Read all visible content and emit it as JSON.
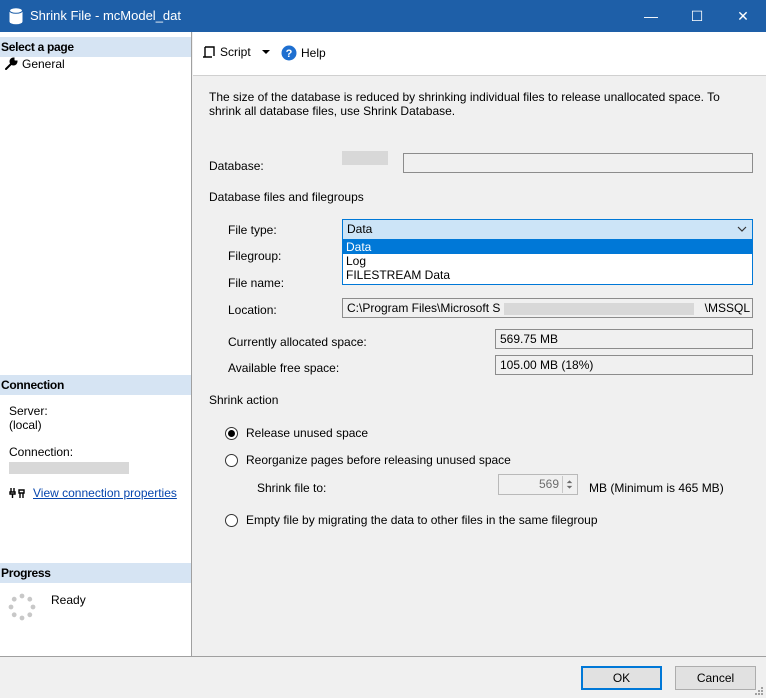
{
  "window": {
    "title": "Shrink File - mcModel_dat",
    "minimize_glyph": "—",
    "maximize_glyph": "☐",
    "close_glyph": "✕"
  },
  "sidebar": {
    "select_page_header": "Select a page",
    "pages": [
      {
        "label": "General",
        "icon": "wrench-icon"
      }
    ],
    "connection_header": "Connection",
    "server_label": "Server:",
    "server_value": "(local)",
    "connection_label": "Connection:",
    "view_connection_link": "View connection properties",
    "progress_header": "Progress",
    "progress_status": "Ready"
  },
  "toolbar": {
    "script_label": "Script",
    "help_label": "Help"
  },
  "main": {
    "description": "The size of the database is reduced by shrinking individual files to release unallocated space. To shrink all database files, use Shrink Database.",
    "database_label": "Database:",
    "files_group_label": "Database files and filegroups",
    "file_type_label": "File type:",
    "file_type_value": "Data",
    "file_type_options": [
      "Data",
      "Log",
      "FILESTREAM Data"
    ],
    "filegroup_label": "Filegroup:",
    "file_name_label": "File name:",
    "location_label": "Location:",
    "location_prefix": "C:\\Program Files\\Microsoft S",
    "location_suffix": "\\MSSQL",
    "allocated_label": "Currently allocated space:",
    "allocated_value": "569.75 MB",
    "free_label": "Available free space:",
    "free_value": "105.00 MB (18%)",
    "shrink_action_label": "Shrink action",
    "radio_release": "Release unused space",
    "radio_reorganize": "Reorganize pages before releasing unused space",
    "shrink_to_label": "Shrink file to:",
    "shrink_to_value": "569",
    "shrink_to_unit": "MB (Minimum is 465 MB)",
    "radio_empty": "Empty file by migrating the data to other files in the same filegroup",
    "selected_action": "release"
  },
  "buttons": {
    "ok": "OK",
    "cancel": "Cancel"
  },
  "colors": {
    "titlebar": "#1e5fa8",
    "section_header": "#d6e4f3",
    "selection": "#0078d7"
  }
}
